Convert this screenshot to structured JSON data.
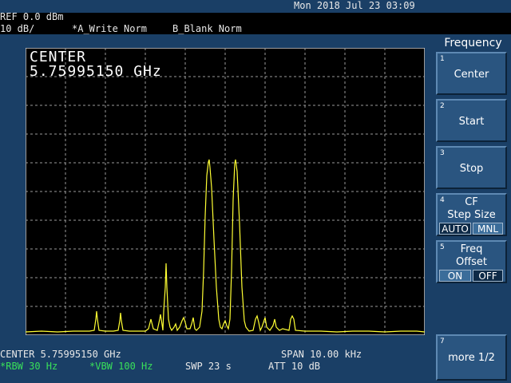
{
  "status": {
    "datetime": "Mon 2018 Jul 23 03:09",
    "ref_level": "REF 0.0 dBm",
    "scale": "10 dB/",
    "trace_a": "*A_Write Norm",
    "trace_b": "B_Blank Norm"
  },
  "marker": {
    "label": "CENTER",
    "value": "5.75995150  GHz"
  },
  "bottom_bar": {
    "center": "CENTER 5.75995150 GHz",
    "span": "SPAN 10.00 kHz",
    "rbw": "*RBW 30 Hz",
    "vbw": "*VBW 100 Hz",
    "sweep": "SWP 23 s",
    "attenuation": "ATT 10 dB"
  },
  "menu": {
    "title": "Frequency",
    "keys": [
      {
        "num": "1",
        "label": "Center"
      },
      {
        "num": "2",
        "label": "Start"
      },
      {
        "num": "3",
        "label": "Stop"
      },
      {
        "num": "4",
        "label_line1": "CF",
        "label_line2": "Step Size",
        "opt_a": "AUTO",
        "opt_b": "MNL"
      },
      {
        "num": "5",
        "label_line1": "Freq",
        "label_line2": "Offset",
        "opt_a": "ON",
        "opt_b": "OFF"
      },
      {
        "num": "7",
        "label": "more 1/2"
      }
    ]
  },
  "colors": {
    "trace": "#ffff33",
    "grid": "#cfcfcf",
    "panel": "#1a3f66",
    "softkey": "#2a5580",
    "highlight": "#39e05a"
  }
}
